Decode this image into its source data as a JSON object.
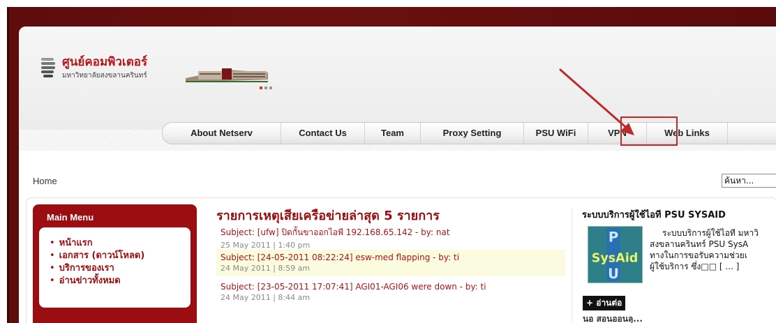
{
  "logo": {
    "title": "ศูนย์คอมพิวเตอร์",
    "subtitle": "มหาวิทยาลัยสงขลานครินทร์"
  },
  "nav": {
    "items": [
      {
        "label": "About Netserv"
      },
      {
        "label": "Contact Us"
      },
      {
        "label": "Team"
      },
      {
        "label": "Proxy Setting"
      },
      {
        "label": "PSU WiFi"
      },
      {
        "label": "VPN"
      },
      {
        "label": "Web Links"
      }
    ],
    "highlighted": "VPN"
  },
  "search": {
    "value": "ค้นหา..."
  },
  "breadcrumb": {
    "home": "Home"
  },
  "main_menu": {
    "title": "Main Menu",
    "items": [
      {
        "label": "หน้าแรก"
      },
      {
        "label": "เอกสาร (ดาวน์โหลด)"
      },
      {
        "label": "บริการของเรา"
      },
      {
        "label": "อ่านข่าวทั้งหมด"
      }
    ]
  },
  "news": {
    "title": "รายการเหตุเสียเครือข่ายล่าสุด 5 รายการ",
    "items": [
      {
        "subject": "Subject: [ufw] ปิดกั้นขาออกไอพี 192.168.65.142 - by: nat",
        "date": "25 May 2011 | 1:40 pm"
      },
      {
        "subject": "Subject: [24-05-2011 08:22:24] esw-med flapping - by: ti",
        "date": "24 May 2011 | 8:59 am"
      },
      {
        "subject": "Subject: [23-05-2011 17:07:41] AGI01-AGI06 were down - by: ti",
        "date": "24 May 2011 | 8:44 am"
      }
    ]
  },
  "sysaid": {
    "title": "ระบบบริการผู้ใช้ไอที PSU SYSAID",
    "logo_text": "SysAid",
    "text_lines": [
      "ระบบบริการผู้ใช้ไอที มหาวิ",
      "สงขลานครินทร์ PSU SysA",
      "ทางในการขอรับความช่วยเ",
      "ผู้ใช้บริการ ซึ่ง□□ [ ... ]"
    ],
    "read_more": "+ อ่านต่อ",
    "next_title_partial": "นอ สอนออนลุ..."
  },
  "colors": {
    "frame": "#5e0c0c",
    "accent_red": "#9b0d10",
    "highlight_box": "#c0292a",
    "link_red": "#b01317"
  }
}
